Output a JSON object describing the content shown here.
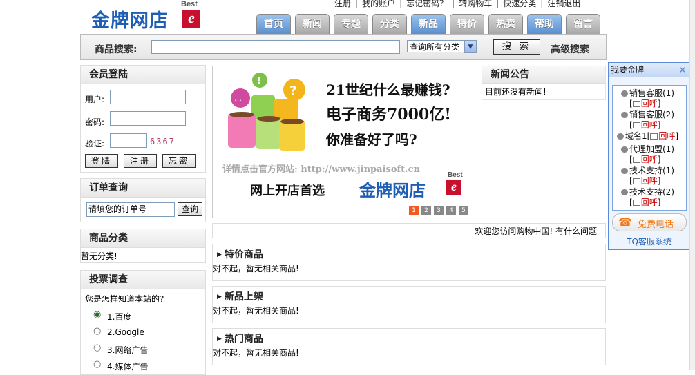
{
  "logo": {
    "text": "金牌网店",
    "best": "Best",
    "e": "e"
  },
  "top_links": [
    "注册",
    "我的账户",
    "忘记密码？",
    "转购物车",
    "快速分类",
    "注销退出"
  ],
  "nav": [
    {
      "label": "首页",
      "active": true
    },
    {
      "label": "新闻",
      "active": false
    },
    {
      "label": "专题",
      "active": false
    },
    {
      "label": "分类",
      "active": false
    },
    {
      "label": "新品",
      "active": true
    },
    {
      "label": "特价",
      "active": false
    },
    {
      "label": "热卖",
      "active": false
    },
    {
      "label": "帮助",
      "active": true
    },
    {
      "label": "留言",
      "active": false
    }
  ],
  "search": {
    "label": "商品搜索:",
    "value": "",
    "select": "查询所有分类",
    "button": "搜 索",
    "advanced": "高级搜索"
  },
  "login": {
    "title": "会员登陆",
    "user_label": "用户:",
    "pass_label": "密码:",
    "code_label": "验证:",
    "captcha": "6367",
    "btn_login": "登陆",
    "btn_register": "注册",
    "btn_forget": "忘密"
  },
  "order": {
    "title": "订单查询",
    "placeholder": "请填您的订单号",
    "button": "查询"
  },
  "category": {
    "title": "商品分类",
    "empty": "暂无分类!"
  },
  "vote": {
    "title": "投票调查",
    "question": "您是怎样知道本站的?",
    "options": [
      "1.百度",
      "2.Google",
      "3.网络广告",
      "4.媒体广告"
    ]
  },
  "banner": {
    "line1": "21世纪什么最赚钱?",
    "line2": "电子商务7000亿!",
    "line3": "你准备好了吗?",
    "url_line": "详情点击官方网站: http://www.jinpaisoft.cn",
    "slogan": "网上开店首选",
    "logo": "金牌网店",
    "best": "Best",
    "e": "e",
    "pages": [
      "1",
      "2",
      "3",
      "4",
      "5"
    ]
  },
  "news": {
    "title": "新闻公告",
    "empty": "目前还没有新闻!"
  },
  "welcome": "欢迎您访问购物中国! 有什么问题",
  "sections": [
    {
      "title": "特价商品",
      "empty": "对不起，暂无相关商品!"
    },
    {
      "title": "新品上架",
      "empty": "对不起，暂无相关商品!"
    },
    {
      "title": "热门商品",
      "empty": "对不起，暂无相关商品!"
    }
  ],
  "service": {
    "title": "我要金牌",
    "close": "×",
    "items": [
      {
        "name": "销售客服(1)",
        "call": "回呼"
      },
      {
        "name": "销售客服(2)",
        "call": "回呼"
      },
      {
        "name": "域名1",
        "call": "回呼"
      },
      {
        "name": "代理加盟(1)",
        "call": "回呼"
      },
      {
        "name": "技术支持(1)",
        "call": "回呼"
      },
      {
        "name": "技术支持(2)",
        "call": "回呼"
      }
    ],
    "free_call": "免费电话",
    "tq": "TQ客服系统"
  },
  "colors": {
    "brand_blue": "#1e5fb5",
    "brand_red": "#c8102e",
    "accent_orange": "#f35a1f"
  }
}
